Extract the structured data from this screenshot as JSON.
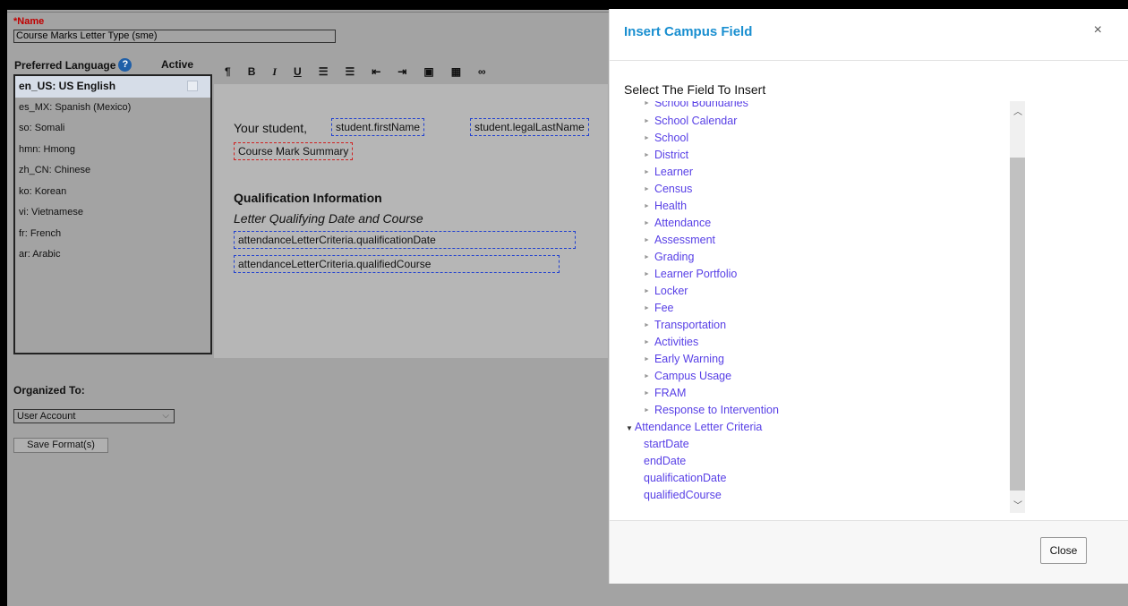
{
  "form": {
    "name_label": "*Name",
    "name_value": "Course Marks Letter Type (sme)",
    "preferred_language_label": "Preferred Language",
    "active_label": "Active",
    "languages": [
      {
        "label": "en_US: US English"
      },
      {
        "label": "es_MX: Spanish (Mexico)"
      },
      {
        "label": "so: Somali"
      },
      {
        "label": "hmn: Hmong"
      },
      {
        "label": "zh_CN: Chinese"
      },
      {
        "label": "ko: Korean"
      },
      {
        "label": "vi: Vietnamese"
      },
      {
        "label": "fr: French"
      },
      {
        "label": "ar: Arabic"
      }
    ],
    "organized_to_label": "Organized To:",
    "organized_to_value": "User Account",
    "save_button": "Save Format(s)"
  },
  "toolbar": {
    "buttons": [
      {
        "glyph": "¶",
        "icon": "paragraph-icon"
      },
      {
        "glyph": "B",
        "icon": "bold-icon"
      },
      {
        "glyph": "I",
        "icon": "italic-icon"
      },
      {
        "glyph": "U",
        "icon": "underline-icon"
      },
      {
        "glyph": "☰",
        "icon": "bulleted-list-icon"
      },
      {
        "glyph": "☰",
        "icon": "numbered-list-icon"
      },
      {
        "glyph": "⇤",
        "icon": "outdent-icon"
      },
      {
        "glyph": "⇥",
        "icon": "indent-icon"
      },
      {
        "glyph": "▣",
        "icon": "image-icon"
      },
      {
        "glyph": "▦",
        "icon": "table-icon"
      },
      {
        "glyph": "∞",
        "icon": "link-icon"
      }
    ]
  },
  "editor": {
    "your_student": "Your student,",
    "first_name_field": "student.firstName",
    "last_name_field": "student.legalLastName",
    "course_mark_summary": "Course Mark Summary",
    "qualification_heading": "Qualification Information",
    "qualification_sub": "Letter Qualifying Date and Course",
    "qualification_date_field": "attendanceLetterCriteria.qualificationDate",
    "qualified_course_field": "attendanceLetterCriteria.qualifiedCourse"
  },
  "modal": {
    "title": "Insert Campus Field",
    "close_x": "×",
    "select_label": "Select The Field To Insert",
    "tree_items": [
      "School Boundaries",
      "School Calendar",
      "School",
      "District",
      "Learner",
      "Census",
      "Health",
      "Attendance",
      "Assessment",
      "Grading",
      "Learner Portfolio",
      "Locker",
      "Fee",
      "Transportation",
      "Activities",
      "Early Warning",
      "Campus Usage",
      "FRAM",
      "Response to Intervention"
    ],
    "expanded_group": "Attendance Letter Criteria",
    "expanded_children": [
      "startDate",
      "endDate",
      "qualificationDate",
      "qualifiedCourse"
    ],
    "close_button": "Close"
  },
  "colors": {
    "link": "#5840e6",
    "title": "#1a8fd0",
    "required": "#c00000",
    "field_border": "#1f3fd0",
    "field_border_red": "#d02020"
  }
}
